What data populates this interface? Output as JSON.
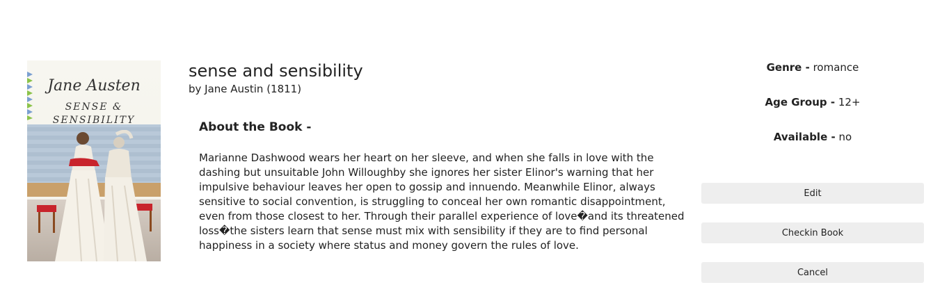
{
  "book": {
    "title": "sense and sensibility",
    "byline": "by Jane Austin (1811)",
    "about_heading": "About the Book -",
    "description": "Marianne Dashwood wears her heart on her sleeve, and when she falls in love with the dashing but unsuitable John Willoughby she ignores her sister Elinor's warning that her impulsive behaviour leaves her open to gossip and innuendo. Meanwhile Elinor, always sensitive to social convention, is struggling to conceal her own romantic disappointment, even from those closest to her. Through their parallel experience of love�and its threatened loss�the sisters learn that sense must mix with sensibility if they are to find personal happiness in a society where status and money govern the rules of love."
  },
  "cover": {
    "author": "Jane Austen",
    "title_line1": "SENSE &",
    "title_line2": "SENSIBILITY"
  },
  "details": {
    "genre_label": "Genre -",
    "genre_value": "romance",
    "age_label": "Age Group -",
    "age_value": "12+",
    "available_label": "Available -",
    "available_value": "no"
  },
  "actions": {
    "edit": "Edit",
    "checkin": "Checkin Book",
    "cancel": "Cancel"
  }
}
